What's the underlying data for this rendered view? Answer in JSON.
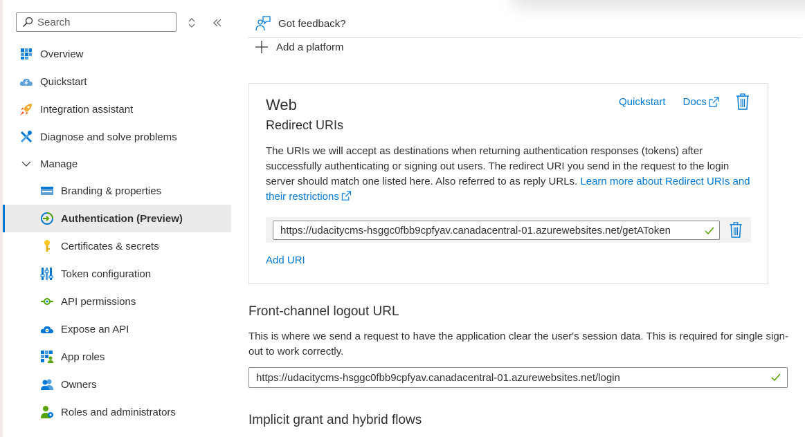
{
  "sidebar": {
    "search_placeholder": "Search",
    "items": [
      {
        "label": "Overview",
        "icon": "grid-icon"
      },
      {
        "label": "Quickstart",
        "icon": "cloud-lightning-icon"
      },
      {
        "label": "Integration assistant",
        "icon": "rocket-icon"
      },
      {
        "label": "Diagnose and solve problems",
        "icon": "wrench-icon"
      },
      {
        "label": "Manage",
        "icon": "chevron-down-icon"
      },
      {
        "label": "Branding & properties",
        "icon": "branding-icon"
      },
      {
        "label": "Authentication (Preview)",
        "icon": "authentication-icon",
        "active": true
      },
      {
        "label": "Certificates & secrets",
        "icon": "key-icon"
      },
      {
        "label": "Token configuration",
        "icon": "token-bars-icon"
      },
      {
        "label": "API permissions",
        "icon": "api-permissions-icon"
      },
      {
        "label": "Expose an API",
        "icon": "cloud-icon"
      },
      {
        "label": "App roles",
        "icon": "app-roles-icon"
      },
      {
        "label": "Owners",
        "icon": "owners-icon"
      },
      {
        "label": "Roles and administrators",
        "icon": "roles-admin-icon"
      }
    ]
  },
  "toolbar": {
    "feedback_label": "Got feedback?",
    "add_platform_label": "Add a platform"
  },
  "web_card": {
    "title": "Web",
    "subtitle": "Redirect URIs",
    "quickstart_link": "Quickstart",
    "docs_link": "Docs",
    "description": "The URIs we will accept as destinations when returning authentication responses (tokens) after successfully authenticating or signing out users. The redirect URI you send in the request to the login server should match one listed here. Also referred to as reply URLs. ",
    "learn_more_link": "Learn more about Redirect URIs and their restrictions",
    "redirect_uri": "https://udacitycms-hsggc0fbb9cpfyav.canadacentral-01.azurewebsites.net/getAToken",
    "add_uri_label": "Add URI"
  },
  "front_channel": {
    "title": "Front-channel logout URL",
    "description": "This is where we send a request to have the application clear the user's session data. This is required for single sign-out to work correctly.",
    "logout_url": "https://udacitycms-hsggc0fbb9cpfyav.canadacentral-01.azurewebsites.net/login"
  },
  "implicit": {
    "title": "Implicit grant and hybrid flows"
  },
  "colors": {
    "accent": "#0078d4",
    "success": "#57a300",
    "active_bg": "#edebe9"
  }
}
